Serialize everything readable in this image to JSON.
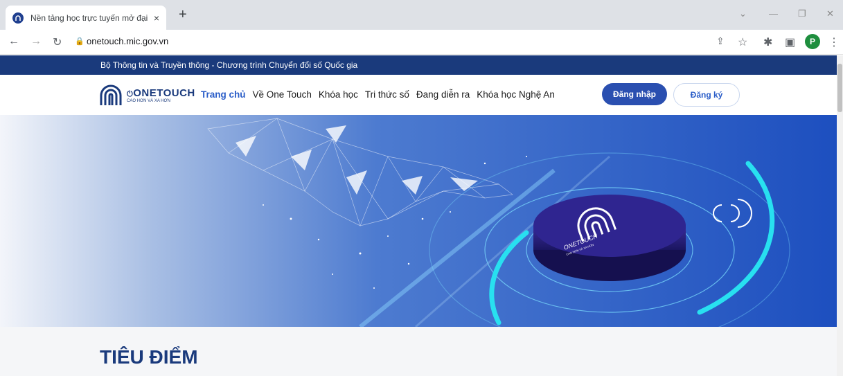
{
  "browser": {
    "tab_title": "Nền tảng học trực tuyến mở đại",
    "tab_close": "×",
    "new_tab": "+",
    "url": "onetouch.mic.gov.vn",
    "profile_initial": "P"
  },
  "site": {
    "top_banner": "Bộ Thông tin và Truyền thông - Chương trình Chuyển đổi số Quốc gia",
    "logo_title": "ONETOUCH",
    "logo_subtitle": "CAO HƠN VÀ XA HƠN",
    "nav": {
      "items": [
        "Trang chủ",
        "Về One Touch",
        "Khóa học",
        "Tri thức số",
        "Đang diễn ra",
        "Khóa học Nghệ An"
      ],
      "active_index": 0
    },
    "login_label": "Đăng nhập",
    "register_label": "Đăng ký",
    "section_heading": "TIÊU ĐIỂM",
    "hero_logo_text": "ONETOUCH",
    "hero_logo_sub": "CAO HƠN VÀ XA HƠN"
  },
  "colors": {
    "brand": "#1a3a7c",
    "accent": "#2a5dc8",
    "cyan": "#28e0f0"
  }
}
